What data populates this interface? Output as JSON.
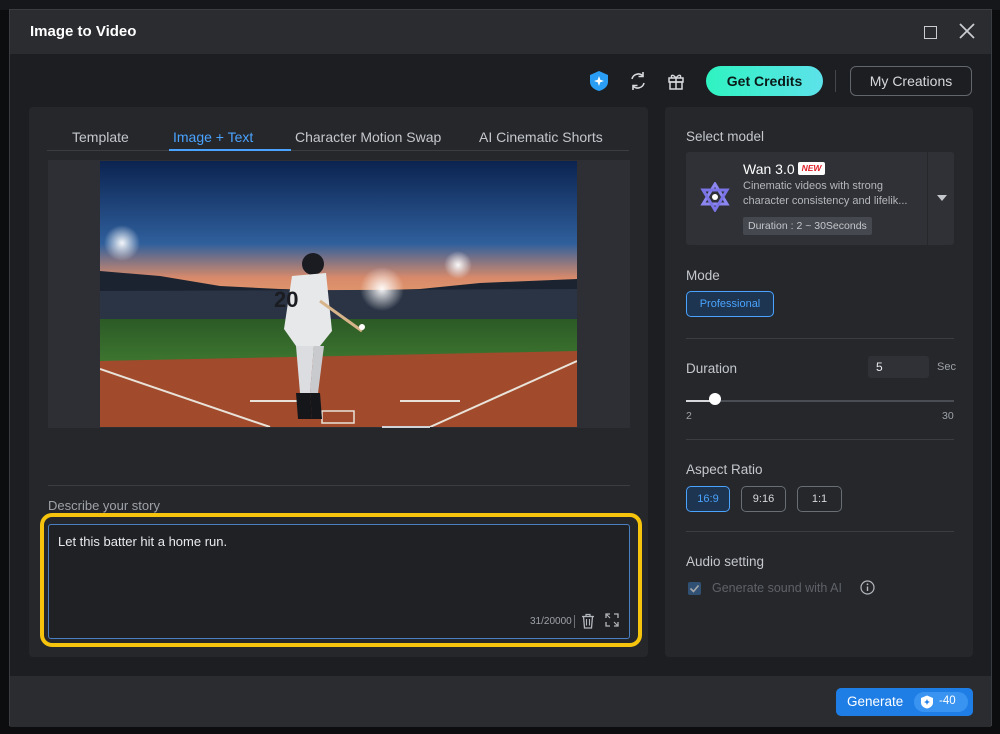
{
  "window": {
    "title": "Image to Video",
    "maximize_icon": "maximize-icon",
    "close_icon": "close-icon"
  },
  "toolbar": {
    "icons": [
      "ai-sparkle-shield-icon",
      "refresh-icon",
      "gift-icon"
    ],
    "get_credits_label": "Get Credits",
    "my_creations_label": "My Creations",
    "accent": "#2ff3c1"
  },
  "tabs": [
    {
      "label": "Template",
      "active": false
    },
    {
      "label": "Image + Text",
      "active": true
    },
    {
      "label": "Character Motion Swap",
      "active": false
    },
    {
      "label": "AI Cinematic Shorts",
      "active": false
    }
  ],
  "story": {
    "label": "Describe your story",
    "text": "Let this batter hit a home run.",
    "counter": "31/20000"
  },
  "model": {
    "section_label": "Select model",
    "name": "Wan 3.0",
    "badge": "NEW",
    "description": "Cinematic videos with strong character consistency and lifelik...",
    "duration_chip": "Duration : 2 ~ 30Seconds"
  },
  "mode": {
    "label": "Mode",
    "options": [
      "Professional"
    ],
    "selected": "Professional"
  },
  "duration": {
    "label": "Duration",
    "value": "5",
    "unit": "Sec",
    "min": "2",
    "max": "30",
    "slider_fraction": 0.107
  },
  "aspect_ratio": {
    "label": "Aspect Ratio",
    "options": [
      "16:9",
      "9:16",
      "1:1"
    ],
    "selected": "16:9"
  },
  "audio": {
    "label": "Audio setting",
    "checkbox_label": "Generate sound with AI",
    "checked": true,
    "disabled": true
  },
  "footer": {
    "generate_label": "Generate",
    "cost": "-40"
  },
  "colors": {
    "primary": "#1f7ee6",
    "highlight": "#f6c40d",
    "active_tab": "#4aa3ff"
  }
}
